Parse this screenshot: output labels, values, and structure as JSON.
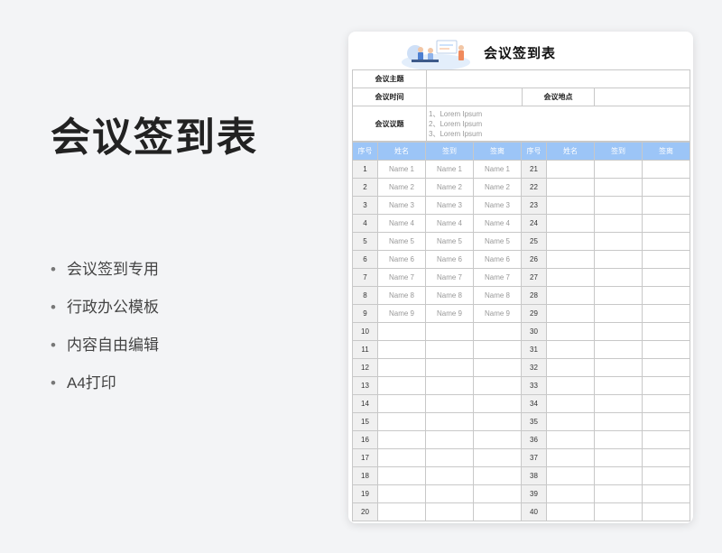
{
  "left": {
    "title": "会议签到表",
    "features": [
      "会议签到专用",
      "行政办公模板",
      "内容自由编辑",
      "A4打印"
    ]
  },
  "sheet": {
    "title": "会议签到表",
    "info": {
      "topic_label": "会议主题",
      "time_label": "会议时间",
      "place_label": "会议地点",
      "agenda_label": "会议议题",
      "agenda_items": [
        "1、Lorem Ipsum",
        "2、Lorem Ipsum",
        "3、Lorem Ipsum"
      ]
    },
    "headers": [
      "序号",
      "姓名",
      "签到",
      "签离",
      "序号",
      "姓名",
      "签到",
      "签离"
    ],
    "rows": [
      {
        "n1": "1",
        "name": "Name 1",
        "in": "Name 1",
        "out": "Name 1",
        "n2": "21"
      },
      {
        "n1": "2",
        "name": "Name 2",
        "in": "Name 2",
        "out": "Name 2",
        "n2": "22"
      },
      {
        "n1": "3",
        "name": "Name 3",
        "in": "Name 3",
        "out": "Name 3",
        "n2": "23"
      },
      {
        "n1": "4",
        "name": "Name 4",
        "in": "Name 4",
        "out": "Name 4",
        "n2": "24"
      },
      {
        "n1": "5",
        "name": "Name 5",
        "in": "Name 5",
        "out": "Name 5",
        "n2": "25"
      },
      {
        "n1": "6",
        "name": "Name 6",
        "in": "Name 6",
        "out": "Name 6",
        "n2": "26"
      },
      {
        "n1": "7",
        "name": "Name 7",
        "in": "Name 7",
        "out": "Name 7",
        "n2": "27"
      },
      {
        "n1": "8",
        "name": "Name 8",
        "in": "Name 8",
        "out": "Name 8",
        "n2": "28"
      },
      {
        "n1": "9",
        "name": "Name 9",
        "in": "Name 9",
        "out": "Name 9",
        "n2": "29"
      },
      {
        "n1": "10",
        "name": "",
        "in": "",
        "out": "",
        "n2": "30"
      },
      {
        "n1": "11",
        "name": "",
        "in": "",
        "out": "",
        "n2": "31"
      },
      {
        "n1": "12",
        "name": "",
        "in": "",
        "out": "",
        "n2": "32"
      },
      {
        "n1": "13",
        "name": "",
        "in": "",
        "out": "",
        "n2": "33"
      },
      {
        "n1": "14",
        "name": "",
        "in": "",
        "out": "",
        "n2": "34"
      },
      {
        "n1": "15",
        "name": "",
        "in": "",
        "out": "",
        "n2": "35"
      },
      {
        "n1": "16",
        "name": "",
        "in": "",
        "out": "",
        "n2": "36"
      },
      {
        "n1": "17",
        "name": "",
        "in": "",
        "out": "",
        "n2": "37"
      },
      {
        "n1": "18",
        "name": "",
        "in": "",
        "out": "",
        "n2": "38"
      },
      {
        "n1": "19",
        "name": "",
        "in": "",
        "out": "",
        "n2": "39"
      },
      {
        "n1": "20",
        "name": "",
        "in": "",
        "out": "",
        "n2": "40"
      }
    ]
  },
  "colors": {
    "header_bg": "#9cc5f7",
    "background": "#f3f4f6"
  }
}
